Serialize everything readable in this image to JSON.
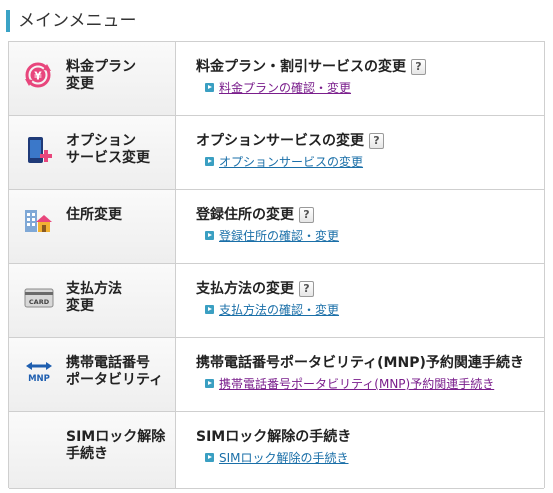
{
  "header": {
    "title": "メインメニュー"
  },
  "rows": [
    {
      "category": "料金プラン\n変更",
      "icon": "yen-cycle-icon",
      "service": "料金プラン・割引サービスの変更",
      "help": "?",
      "link": "料金プランの確認・変更",
      "link_visited": true
    },
    {
      "category": "オプション\nサービス変更",
      "icon": "smartphone-plus-icon",
      "service": "オプションサービスの変更",
      "help": "?",
      "link": "オプションサービスの変更",
      "link_visited": false
    },
    {
      "category": "住所変更",
      "icon": "building-house-icon",
      "service": "登録住所の変更",
      "help": "?",
      "link": "登録住所の確認・変更",
      "link_visited": false
    },
    {
      "category": "支払方法\n変更",
      "icon": "card-icon",
      "service": "支払方法の変更",
      "help": "?",
      "link": "支払方法の確認・変更",
      "link_visited": false,
      "icon_text": "CARD"
    },
    {
      "category": "携帯電話番号\nポータビリティ",
      "icon": "mnp-arrows-icon",
      "service": "携帯電話番号ポータビリティ(MNP)予約関連手続き",
      "help": "",
      "link": "携帯電話番号ポータビリティ(MNP)予約関連手続き",
      "link_visited": true,
      "icon_text": "MNP"
    },
    {
      "category": "SIMロック解除\n手続き",
      "icon": "",
      "service": "SIMロック解除の手続き",
      "help": "",
      "link": "SIMロック解除の手続き",
      "link_visited": false
    }
  ],
  "colors": {
    "accent": "#3aa3c6",
    "link": "#1a6fa8",
    "visited": "#7a1e8c",
    "border": "#cfcfcf"
  }
}
